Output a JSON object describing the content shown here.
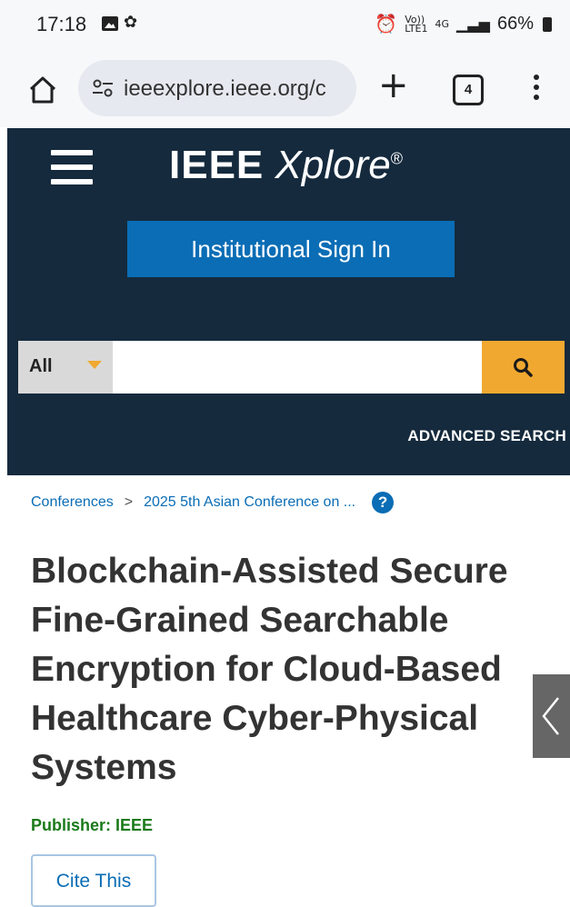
{
  "status_bar": {
    "time": "17:18",
    "gallery_icon": "gallery-icon",
    "app_icon": "app-icon",
    "volte": "Vo))",
    "lte": "LTE1",
    "network": "4G",
    "signal_icon": "signal-icon",
    "battery": "66%"
  },
  "browser": {
    "url": "ieeexplore.ieee.org/c",
    "tab_count": "4",
    "new_tab_symbol": "+"
  },
  "header": {
    "logo_main": "IEEE",
    "logo_italic": "Xplore",
    "logo_reg": "®",
    "signin_label": "Institutional Sign In",
    "search": {
      "scope_label": "All",
      "placeholder": ""
    },
    "advanced_search_label": "ADVANCED SEARCH"
  },
  "breadcrumb": {
    "item1": "Conferences",
    "separator": ">",
    "item2": "2025 5th Asian Conference on ...",
    "help": "?"
  },
  "article": {
    "title": "Blockchain-Assisted Secure Fine-Grained Searchable Encryption for Cloud-Based Healthcare Cyber-Physical Systems",
    "publisher": "Publisher:  IEEE",
    "cite_label": "Cite This"
  },
  "colors": {
    "header_bg": "#152a3d",
    "brand_blue": "#0a6db5",
    "search_orange": "#f0a830",
    "publisher_green": "#1a7a1a"
  }
}
